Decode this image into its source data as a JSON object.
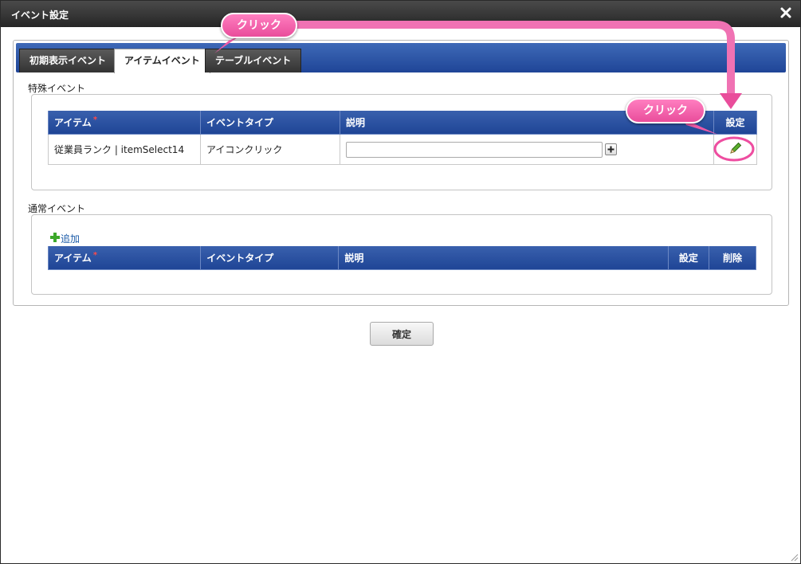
{
  "dialog": {
    "title": "イベント設定",
    "close_icon": "close-icon"
  },
  "tabs": [
    {
      "label": "初期表示イベント",
      "active": false
    },
    {
      "label": "アイテムイベント",
      "active": true
    },
    {
      "label": "テーブルイベント",
      "active": false
    }
  ],
  "special_events": {
    "label": "特殊イベント",
    "columns": [
      "アイテム",
      "イベントタイプ",
      "説明",
      "設定"
    ],
    "required_mark": "*",
    "rows": [
      {
        "item": "従業員ランク | itemSelect14",
        "event_type": "アイコンクリック",
        "description": "",
        "edit_icon": "pencil-icon",
        "add_icon": "plus-icon"
      }
    ]
  },
  "normal_events": {
    "label": "通常イベント",
    "add_label": "追加",
    "add_icon": "green-plus-icon",
    "columns": [
      "アイテム",
      "イベントタイプ",
      "説明",
      "設定",
      "削除"
    ],
    "required_mark": "*"
  },
  "confirm_label": "確定",
  "annotations": {
    "callout_1": "クリック",
    "callout_2": "クリック",
    "color": "#ee5aa6"
  },
  "colors": {
    "header_blue": "#2a50a0",
    "titlebar": "#333333",
    "required": "#ff4a4a"
  }
}
